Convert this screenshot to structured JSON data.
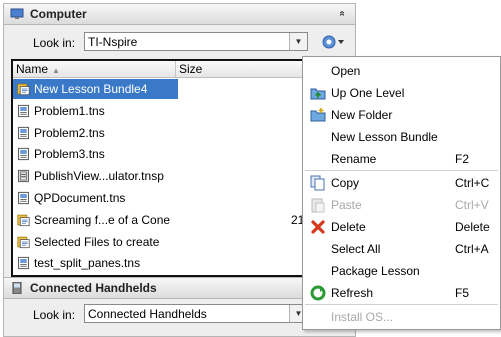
{
  "top_panel": {
    "title": "Computer",
    "collapse_glyph": "»",
    "look_in_label": "Look in:",
    "look_in_value": "TI-Nspire",
    "column_name": "Name",
    "column_size": "Size",
    "files": [
      {
        "name": "New Lesson Bundle4",
        "size": "",
        "icon": "lesson-bundle-icon",
        "selected": true
      },
      {
        "name": "Problem1.tns",
        "size": "",
        "icon": "tns-file-icon"
      },
      {
        "name": "Problem2.tns",
        "size": "",
        "icon": "tns-file-icon"
      },
      {
        "name": "Problem3.tns",
        "size": "",
        "icon": "tns-file-icon"
      },
      {
        "name": "PublishView...ulator.tnsp",
        "size": "",
        "icon": "tnsp-file-icon"
      },
      {
        "name": "QPDocument.tns",
        "size": "",
        "icon": "tns-file-icon"
      },
      {
        "name": "Screaming f...e of a Cone",
        "size": "21",
        "icon": "lesson-bundle-icon"
      },
      {
        "name": "Selected Files to create",
        "size": "",
        "icon": "lesson-bundle-icon"
      },
      {
        "name": "test_split_panes.tns",
        "size": "",
        "icon": "tns-file-icon"
      }
    ]
  },
  "bottom_panel": {
    "title": "Connected Handhelds",
    "look_in_label": "Look in:",
    "look_in_value": "Connected Handhelds"
  },
  "context_menu": {
    "items": [
      {
        "label": "Open",
        "shortcut": "",
        "icon": "",
        "enabled": true
      },
      {
        "label": "Up One Level",
        "shortcut": "",
        "icon": "up-folder-icon",
        "enabled": true
      },
      {
        "label": "New Folder",
        "shortcut": "",
        "icon": "new-folder-icon",
        "enabled": true
      },
      {
        "label": "New Lesson Bundle",
        "shortcut": "",
        "icon": "",
        "enabled": true
      },
      {
        "label": "Rename",
        "shortcut": "F2",
        "icon": "",
        "enabled": true
      },
      {
        "label": "Copy",
        "shortcut": "Ctrl+C",
        "icon": "copy-icon",
        "enabled": true
      },
      {
        "label": "Paste",
        "shortcut": "Ctrl+V",
        "icon": "paste-icon",
        "enabled": false
      },
      {
        "label": "Delete",
        "shortcut": "Delete",
        "icon": "delete-icon",
        "enabled": true
      },
      {
        "label": "Select All",
        "shortcut": "Ctrl+A",
        "icon": "",
        "enabled": true
      },
      {
        "label": "Package Lesson",
        "shortcut": "",
        "icon": "",
        "enabled": true
      },
      {
        "label": "Refresh",
        "shortcut": "F5",
        "icon": "refresh-icon",
        "enabled": true
      },
      {
        "label": "Install OS...",
        "shortcut": "",
        "icon": "",
        "enabled": false
      }
    ]
  },
  "colors": {
    "selection": "#3a79c7",
    "disabled_text": "#a8a8a8"
  }
}
